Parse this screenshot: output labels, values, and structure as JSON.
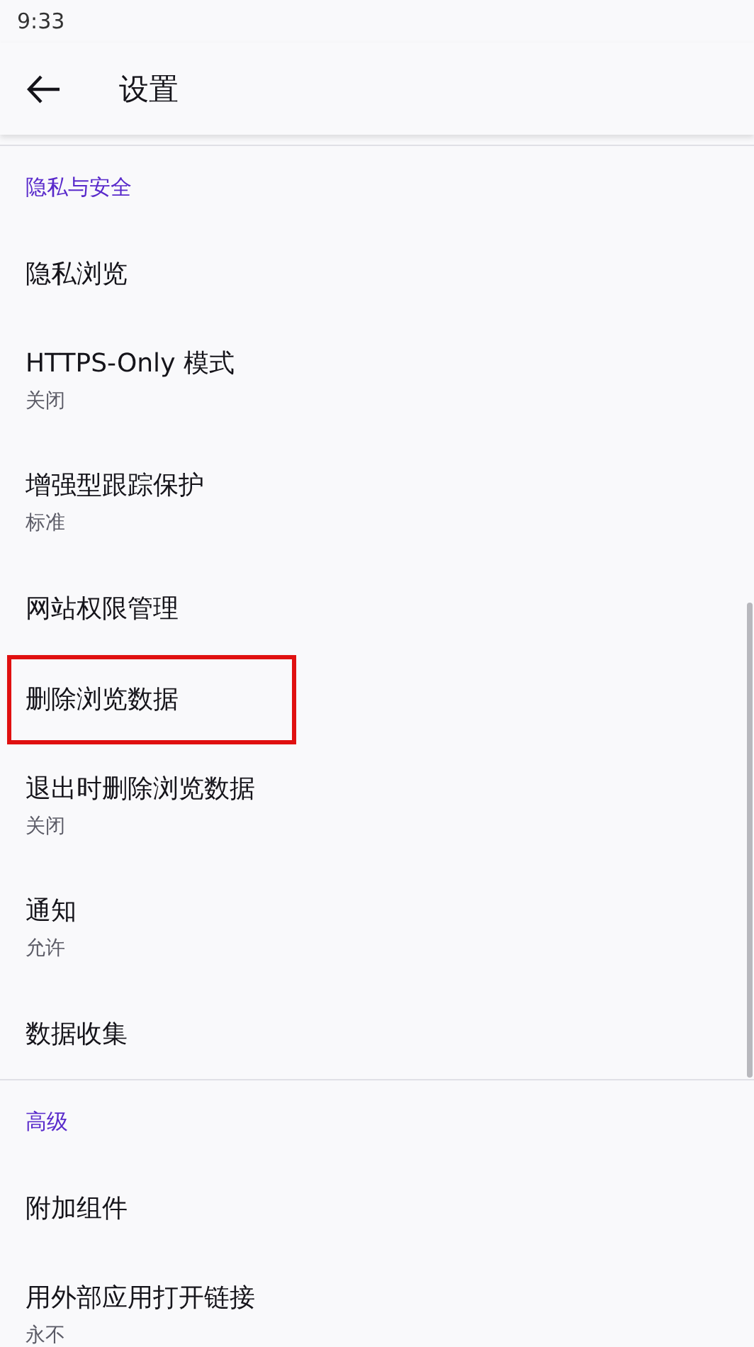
{
  "status_bar": {
    "time": "9:33"
  },
  "toolbar": {
    "title": "设置"
  },
  "sections": [
    {
      "header": "隐私与安全",
      "items": [
        {
          "title": "隐私浏览",
          "highlighted": false
        },
        {
          "title": "HTTPS-Only 模式",
          "summary": "关闭",
          "highlighted": false
        },
        {
          "title": "增强型跟踪保护",
          "summary": "标准",
          "highlighted": false
        },
        {
          "title": "网站权限管理",
          "highlighted": false
        },
        {
          "title": "删除浏览数据",
          "highlighted": true
        },
        {
          "title": "退出时删除浏览数据",
          "summary": "关闭",
          "highlighted": false
        },
        {
          "title": "通知",
          "summary": "允许",
          "highlighted": false
        },
        {
          "title": "数据收集",
          "highlighted": false
        }
      ]
    },
    {
      "header": "高级",
      "items": [
        {
          "title": "附加组件",
          "highlighted": false
        },
        {
          "title": "用外部应用打开链接",
          "summary": "永不",
          "highlighted": false
        }
      ]
    }
  ]
}
